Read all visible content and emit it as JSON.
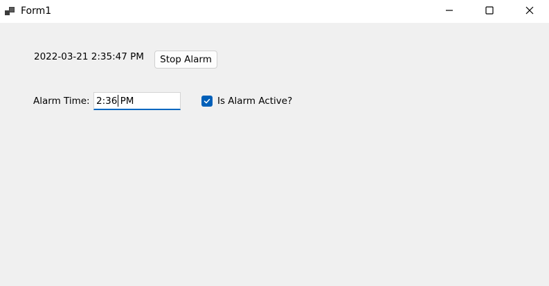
{
  "window": {
    "title": "Form1",
    "controls": {
      "minimize_icon": "minimize-icon",
      "maximize_icon": "maximize-icon",
      "close_icon": "close-icon"
    }
  },
  "main": {
    "timestamp": "2022-03-21 2:35:47 PM",
    "stop_button_label": "Stop Alarm",
    "alarm_time_label": "Alarm Time:",
    "alarm_time_value": "2:36 PM",
    "alarm_active_label": "Is Alarm Active?",
    "alarm_active_checked": true
  },
  "colors": {
    "accent": "#0067c0",
    "checkbox_fill": "#005fb8",
    "background": "#f0f0f0",
    "titlebar": "#ffffff"
  }
}
